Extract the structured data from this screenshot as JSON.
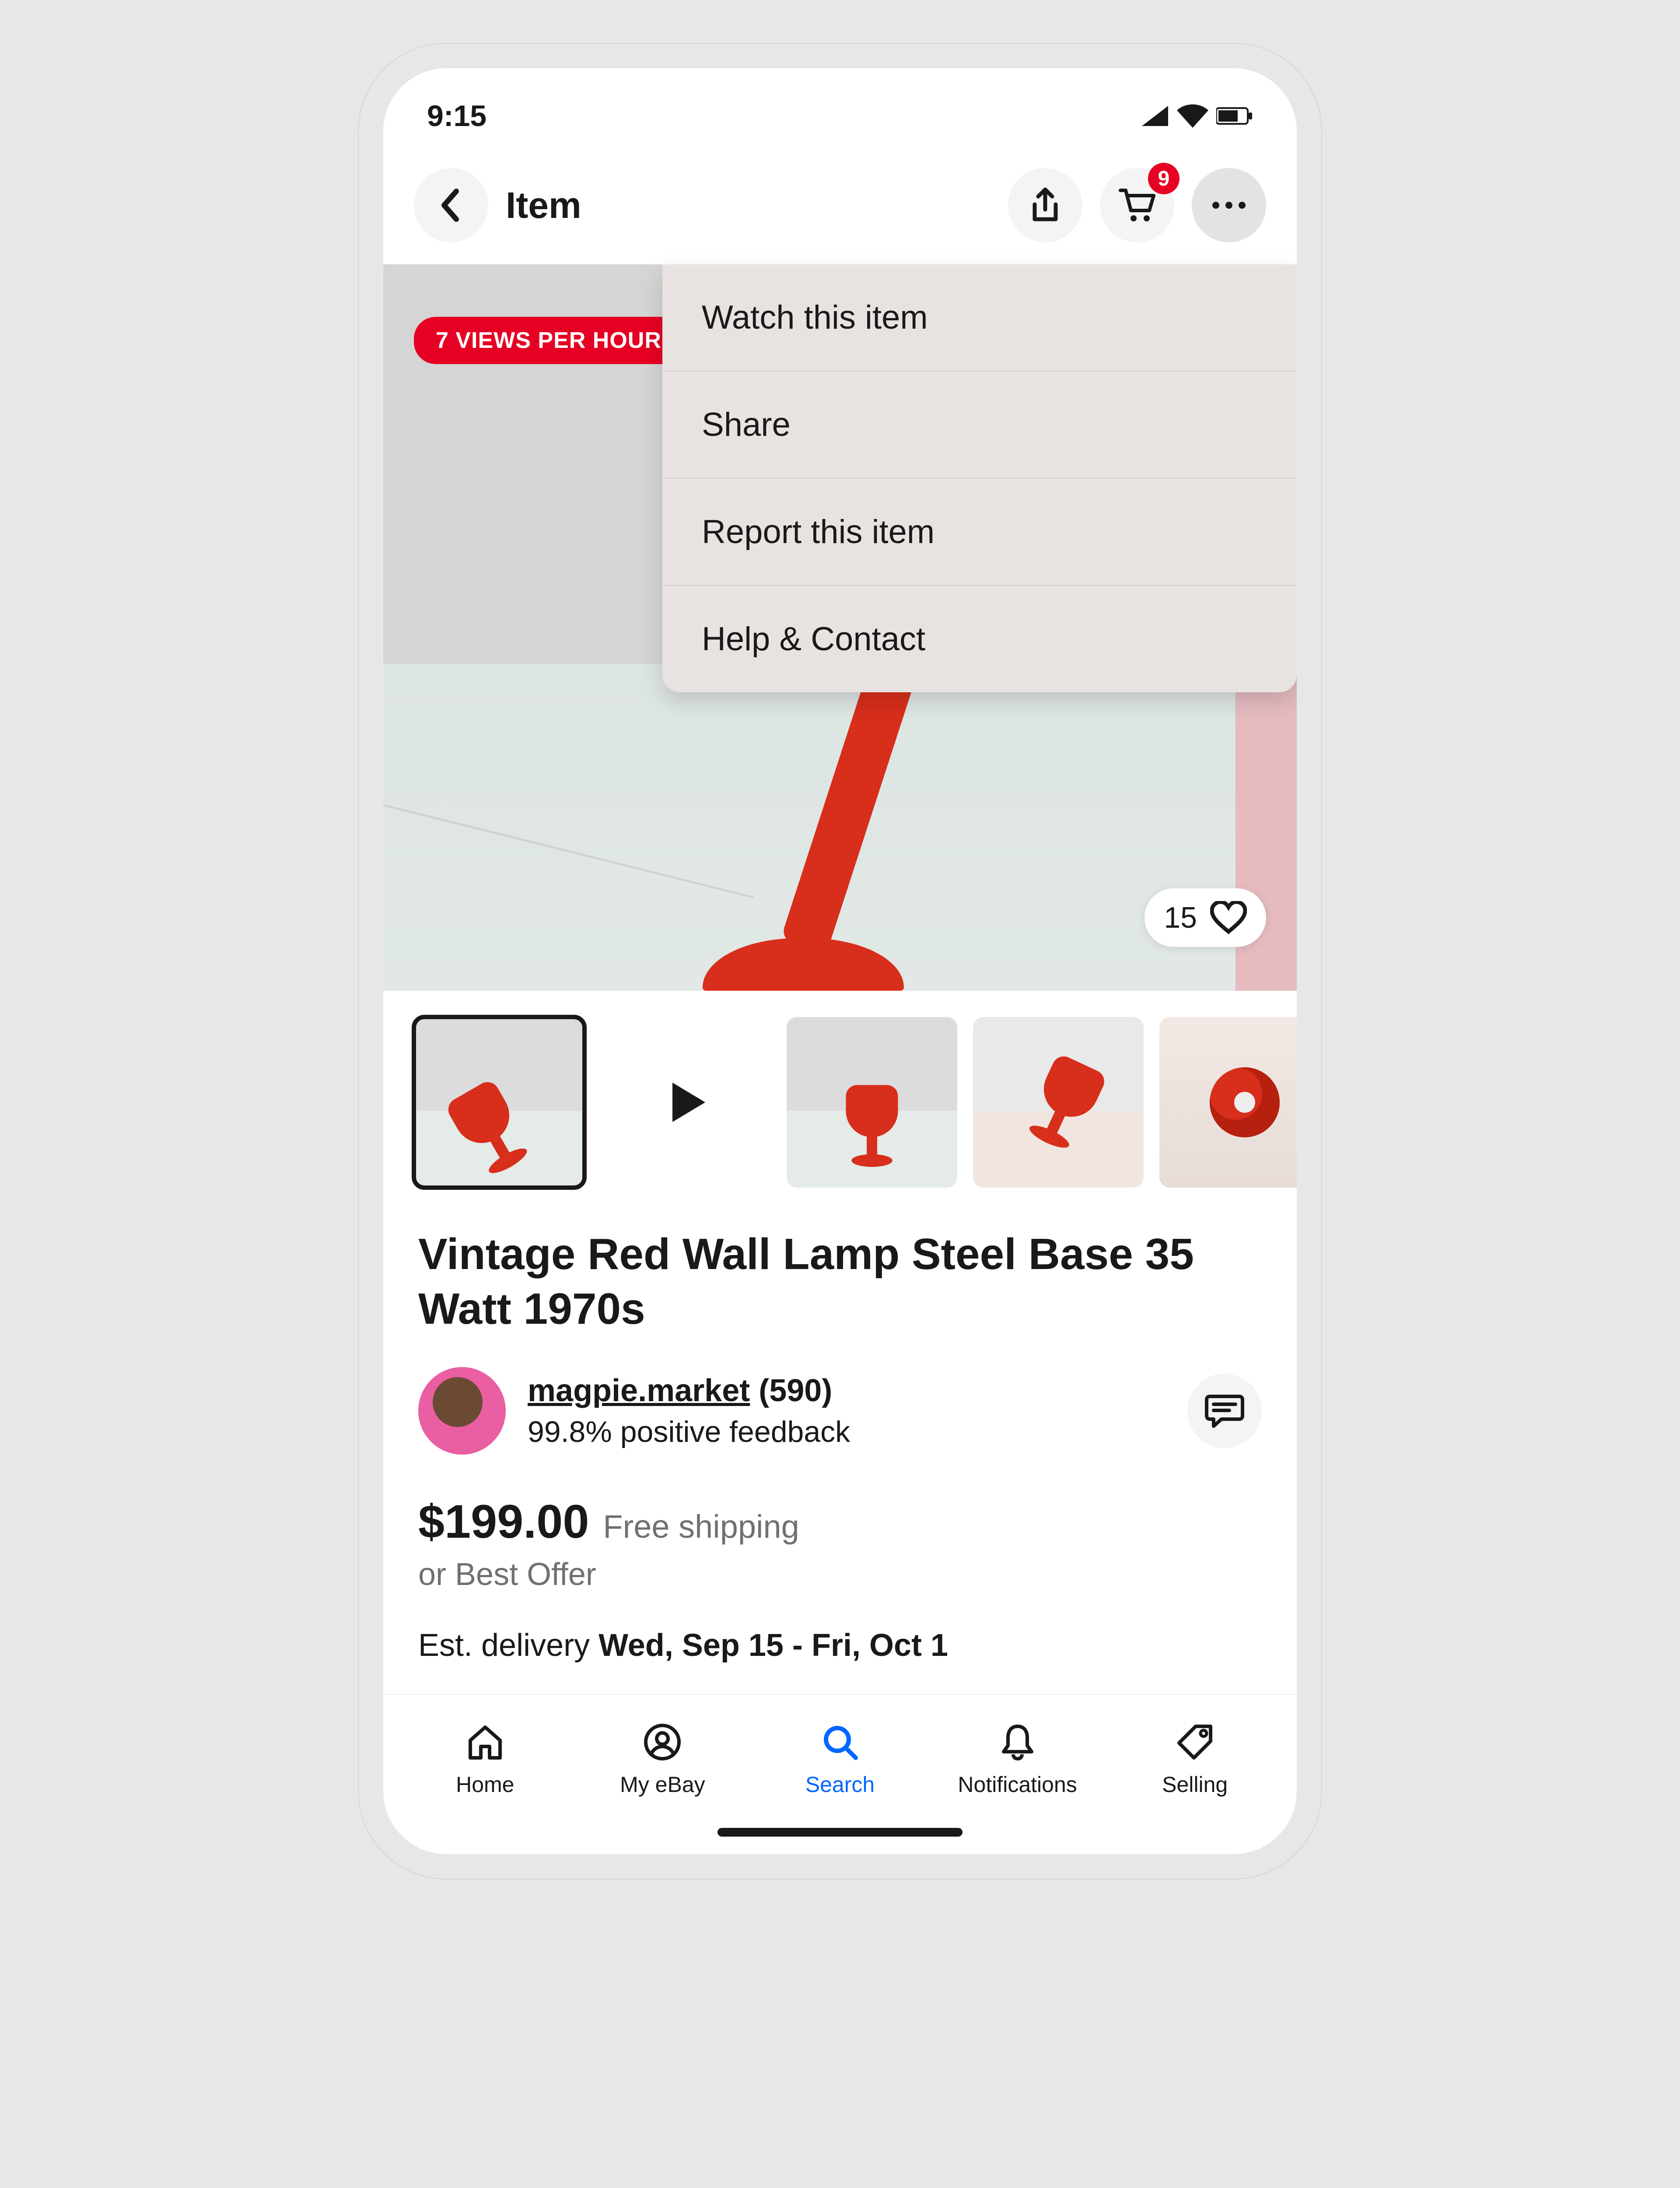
{
  "status": {
    "time": "9:15"
  },
  "header": {
    "title": "Item",
    "cart_badge": "9",
    "menu": {
      "items": [
        "Watch this item",
        "Share",
        "Report this item",
        "Help & Contact"
      ]
    }
  },
  "hero": {
    "views_badge": "7 VIEWS PER HOUR",
    "likes": "15"
  },
  "listing": {
    "title": "Vintage Red Wall Lamp Steel Base 35 Watt 1970s"
  },
  "seller": {
    "username": "magpie.market",
    "rating_count": "(590)",
    "feedback": "99.8% positive feedback"
  },
  "pricing": {
    "price": "$199.00",
    "shipping": "Free shipping",
    "offer": "or Best Offer",
    "delivery_prefix": "Est. delivery ",
    "delivery_dates": "Wed, Sep 15 - Fri, Oct 1"
  },
  "nav": {
    "home": "Home",
    "myebay": "My eBay",
    "search": "Search",
    "notifications": "Notifications",
    "selling": "Selling"
  }
}
